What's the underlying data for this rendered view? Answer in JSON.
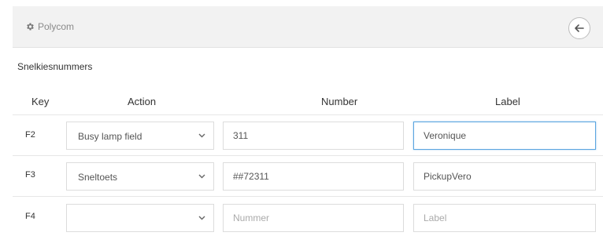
{
  "header": {
    "title": "Polycom",
    "gear_icon": "gear-icon",
    "back_icon": "arrow-left-icon"
  },
  "section": {
    "title": "Snelkiesnummers"
  },
  "columns": {
    "key": "Key",
    "action": "Action",
    "number": "Number",
    "label": "Label"
  },
  "rows": [
    {
      "key": "F2",
      "action": "Busy lamp field",
      "number": "311",
      "label": "Veronique",
      "number_placeholder": "",
      "label_placeholder": ""
    },
    {
      "key": "F3",
      "action": "Sneltoets",
      "number": "##72311",
      "label": "PickupVero",
      "number_placeholder": "",
      "label_placeholder": ""
    },
    {
      "key": "F4",
      "action": "",
      "number": "",
      "label": "",
      "number_placeholder": "Nummer",
      "label_placeholder": "Label"
    }
  ],
  "colors": {
    "focus": "#5aa5e0",
    "header_bg": "#f2f2f2"
  }
}
